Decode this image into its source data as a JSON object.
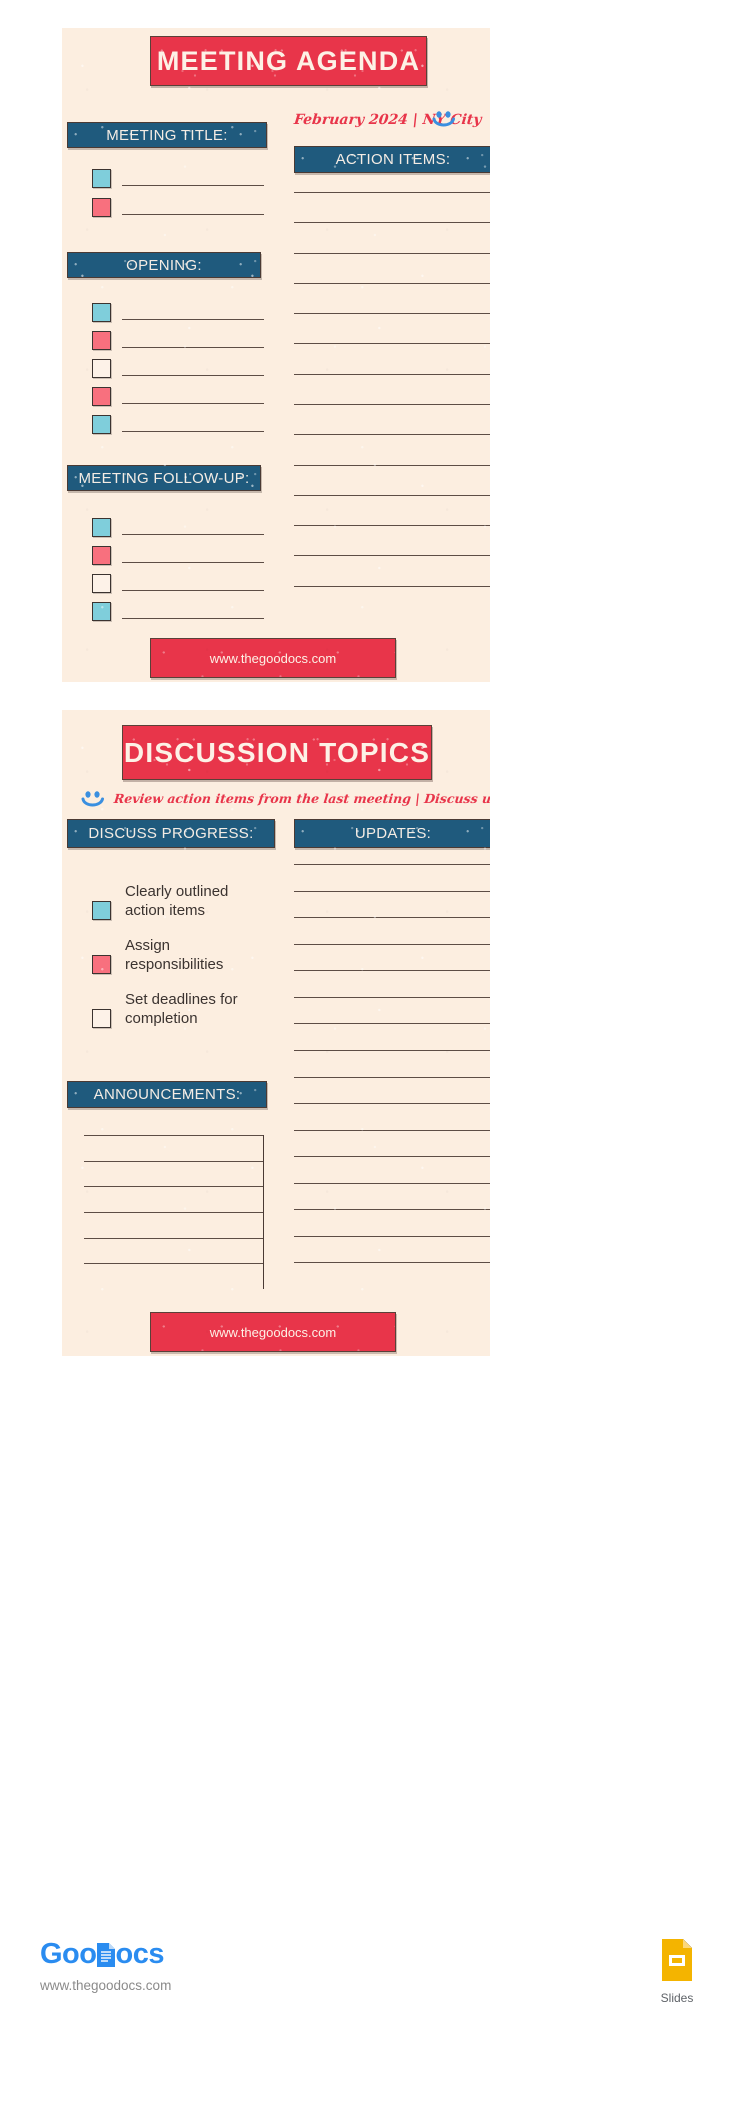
{
  "theme": {
    "paper": "#fceee0",
    "red": "#e8354a",
    "blue": "#1f5a7d",
    "teal": "#7fcedb",
    "pink": "#f8707e",
    "ink": "#3b3330",
    "logo_blue": "#2a8cf0"
  },
  "page1": {
    "title": "MEETING AGENDA",
    "date_location": "February 2024 | NY City",
    "smiley_icon": "smiley-face-icon",
    "meeting_title": {
      "heading": "MEETING TITLE:",
      "rows": [
        {
          "box": "teal"
        },
        {
          "box": "pink"
        }
      ]
    },
    "opening": {
      "heading": "OPENING:",
      "rows": [
        {
          "box": "teal"
        },
        {
          "box": "pink"
        },
        {
          "box": "blank"
        },
        {
          "box": "pink"
        },
        {
          "box": "teal"
        }
      ]
    },
    "follow_up": {
      "heading": "MEETING FOLLOW-UP:",
      "rows": [
        {
          "box": "teal"
        },
        {
          "box": "pink"
        },
        {
          "box": "blank"
        },
        {
          "box": "teal"
        }
      ]
    },
    "action_items": {
      "heading": "ACTION ITEMS:",
      "line_count": 14
    },
    "footer_url": "www.thegoodocs.com"
  },
  "page2": {
    "title": "DISCUSSION TOPICS",
    "subtitle": "Review action items from the last meeting | Discuss upcoming events",
    "smiley_icon": "smiley-face-icon",
    "discuss_progress": {
      "heading": "DISCUSS PROGRESS:",
      "items": [
        {
          "box": "teal",
          "label": "Clearly outlined action items"
        },
        {
          "box": "pink",
          "label": "Assign responsibilities"
        },
        {
          "box": "blank",
          "label": "Set deadlines for completion"
        }
      ]
    },
    "announcements": {
      "heading": "ANNOUNCEMENTS:",
      "line_count": 6
    },
    "updates": {
      "heading": "UPDATES:",
      "line_count": 16
    },
    "footer_url": "www.thegoodocs.com"
  },
  "brand": {
    "logo_text_1": "Goo",
    "logo_text_2": "ocs",
    "url": "www.thegoodocs.com",
    "slides_label": "Slides",
    "slides_icon": "google-slides-icon"
  }
}
